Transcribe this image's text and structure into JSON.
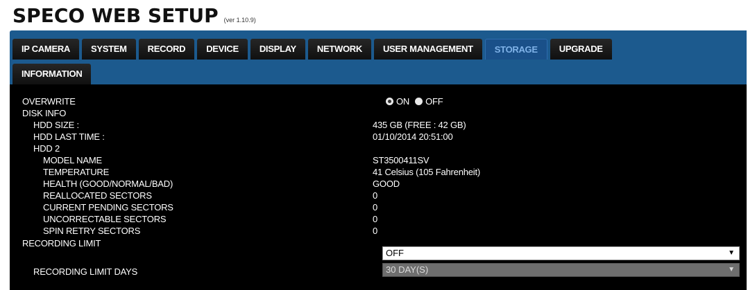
{
  "header": {
    "title": "SPECO WEB SETUP",
    "version": "(ver 1.10.9)"
  },
  "tabs": {
    "row1": [
      {
        "label": "IP CAMERA",
        "active": false
      },
      {
        "label": "SYSTEM",
        "active": false
      },
      {
        "label": "RECORD",
        "active": false
      },
      {
        "label": "DEVICE",
        "active": false
      },
      {
        "label": "DISPLAY",
        "active": false
      },
      {
        "label": "NETWORK",
        "active": false
      },
      {
        "label": "USER MANAGEMENT",
        "active": false
      },
      {
        "label": "STORAGE",
        "active": true
      },
      {
        "label": "UPGRADE",
        "active": false
      }
    ],
    "row2": [
      {
        "label": "INFORMATION",
        "active": false
      }
    ]
  },
  "storage": {
    "overwrite": {
      "label": "OVERWRITE",
      "on_label": "ON",
      "off_label": "OFF",
      "selected": "ON"
    },
    "disk_info_label": "DISK INFO",
    "hdd_size": {
      "label": "HDD SIZE :",
      "value": "435 GB (FREE : 42 GB)"
    },
    "hdd_last_time": {
      "label": "HDD LAST TIME :",
      "value": "01/10/2014 20:51:00"
    },
    "hdd2_label": "HDD 2",
    "model_name": {
      "label": "MODEL NAME",
      "value": "ST3500411SV"
    },
    "temperature": {
      "label": "TEMPERATURE",
      "value": "41 Celsius (105 Fahrenheit)"
    },
    "health": {
      "label": "HEALTH (GOOD/NORMAL/BAD)",
      "value": "GOOD"
    },
    "reallocated": {
      "label": "REALLOCATED SECTORS",
      "value": "0"
    },
    "pending": {
      "label": "CURRENT PENDING SECTORS",
      "value": "0"
    },
    "uncorrectable": {
      "label": "UNCORRECTABLE SECTORS",
      "value": "0"
    },
    "spin_retry": {
      "label": "SPIN RETRY SECTORS",
      "value": "0"
    },
    "recording_limit": {
      "label": "RECORDING LIMIT",
      "value": "OFF"
    },
    "recording_limit_days": {
      "label": "RECORDING LIMIT DAYS",
      "value": "30 DAY(S)"
    }
  },
  "icons": {
    "dropdown_caret": "▼"
  }
}
